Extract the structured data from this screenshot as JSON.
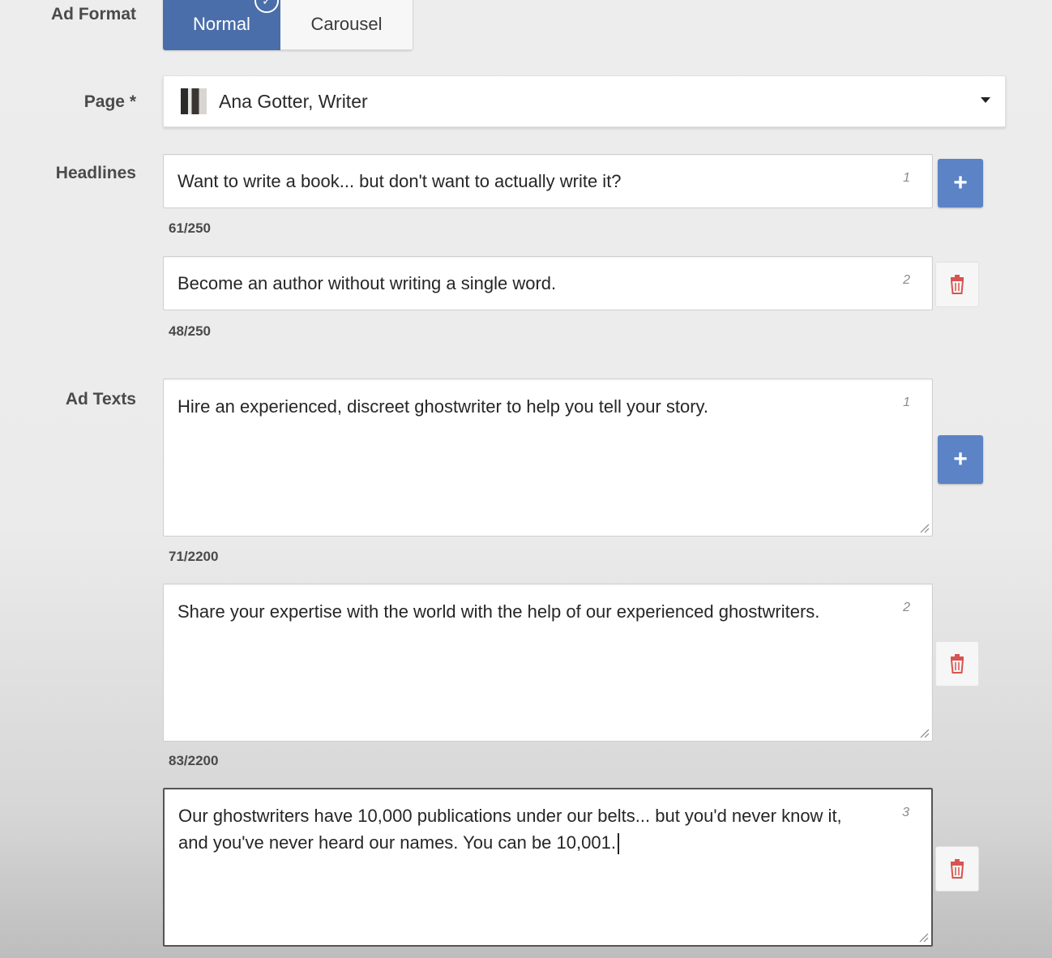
{
  "ad_format": {
    "label": "Ad Format",
    "options": [
      "Normal",
      "Carousel"
    ],
    "selected": "Normal"
  },
  "page": {
    "label": "Page *",
    "value": "Ana Gotter, Writer"
  },
  "headlines": {
    "label": "Headlines",
    "items": [
      {
        "text": "Want to write a book... but don't want to actually write it?",
        "index": "1",
        "count": "61/250"
      },
      {
        "text": "Become an author without writing a single word.",
        "index": "2",
        "count": "48/250"
      }
    ]
  },
  "ad_texts": {
    "label": "Ad Texts",
    "items": [
      {
        "text": "Hire an experienced, discreet ghostwriter to help you tell your story.",
        "index": "1",
        "count": "71/2200"
      },
      {
        "text": "Share your expertise with the world with the help of our experienced ghostwriters.",
        "index": "2",
        "count": "83/2200"
      },
      {
        "text": "Our ghostwriters have 10,000 publications under our belts... but you'd never know it, and you've never heard our names. You can be 10,001.",
        "index": "3"
      }
    ]
  },
  "icons": {
    "add": "plus-icon",
    "delete": "trash-icon",
    "dropdown": "caret-down-icon",
    "selected": "check-icon"
  },
  "colors": {
    "primary": "#4a6ea9",
    "add_button": "#5b83c6",
    "delete_icon": "#d9534f"
  }
}
